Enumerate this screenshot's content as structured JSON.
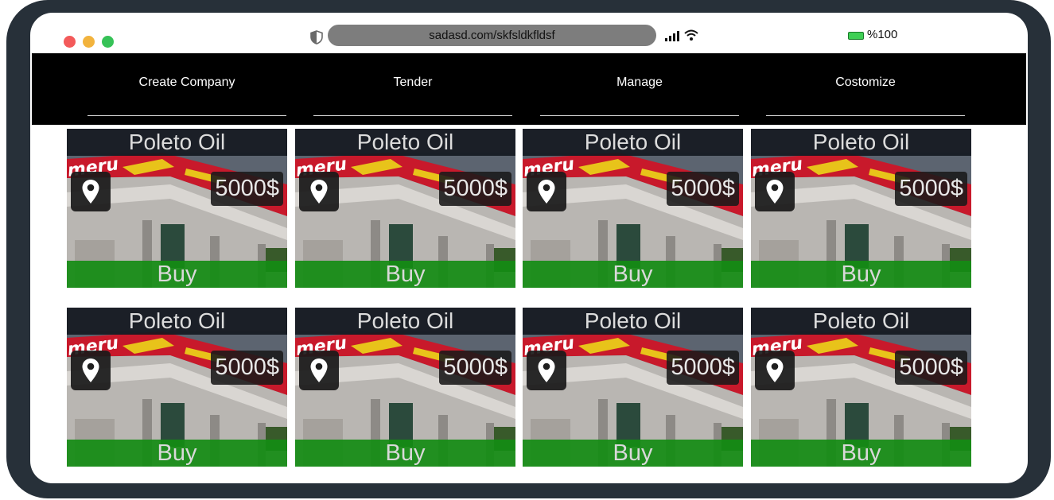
{
  "browser": {
    "url": "sadasd.com/skfsldkfldsf",
    "battery": "%100"
  },
  "nav": {
    "items": [
      {
        "label": "Create Company"
      },
      {
        "label": "Tender"
      },
      {
        "label": "Manage"
      },
      {
        "label": "Costomize"
      }
    ]
  },
  "cards": [
    {
      "title": "Poleto Oil",
      "price": "5000$",
      "buy": "Buy"
    },
    {
      "title": "Poleto Oil",
      "price": "5000$",
      "buy": "Buy"
    },
    {
      "title": "Poleto Oil",
      "price": "5000$",
      "buy": "Buy"
    },
    {
      "title": "Poleto Oil",
      "price": "5000$",
      "buy": "Buy"
    },
    {
      "title": "Poleto Oil",
      "price": "5000$",
      "buy": "Buy"
    },
    {
      "title": "Poleto Oil",
      "price": "5000$",
      "buy": "Buy"
    },
    {
      "title": "Poleto Oil",
      "price": "5000$",
      "buy": "Buy"
    },
    {
      "title": "Poleto Oil",
      "price": "5000$",
      "buy": "Buy"
    }
  ],
  "photo": {
    "brand_text": "meru"
  },
  "icons": {
    "location": "map-pin-icon",
    "shield": "shield-icon",
    "signal": "signal-icon",
    "wifi": "wifi-icon",
    "battery": "battery-icon"
  },
  "colors": {
    "nav_bg": "#000000",
    "buy_bg": "#148c14",
    "device_frame": "#273039"
  }
}
